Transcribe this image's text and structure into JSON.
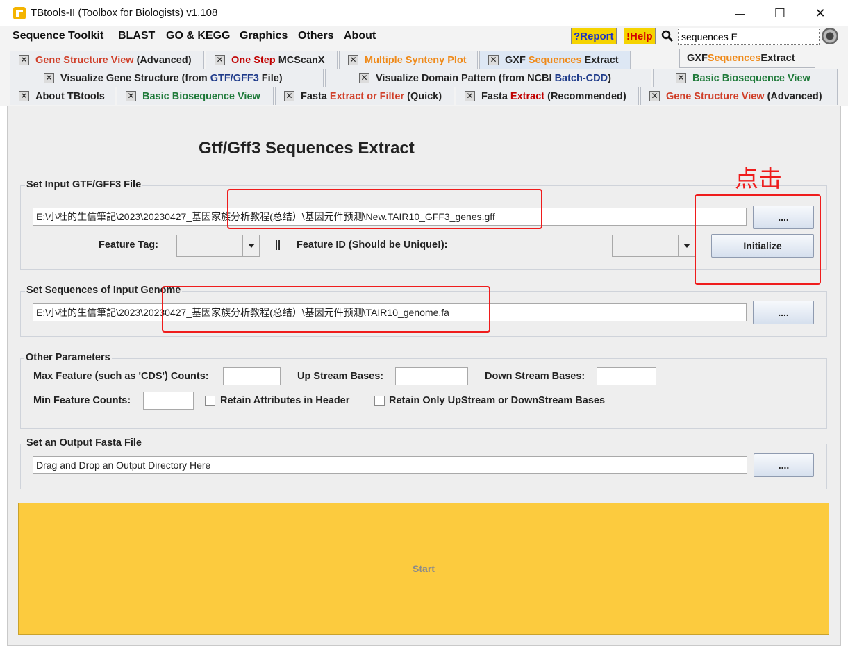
{
  "window": {
    "title": "TBtools-II (Toolbox for Biologists) v1.108",
    "minimize": "—",
    "maximize": "☐",
    "close": "✕"
  },
  "menu": {
    "items": [
      "Sequence Toolkit",
      "BLAST",
      "GO & KEGG",
      "Graphics",
      "Others",
      "About"
    ],
    "report": "?Report",
    "help": "!Help",
    "search_value": "sequences E"
  },
  "tooltip": {
    "prefix": "GXF ",
    "highlight": "Sequences",
    "suffix": " Extract"
  },
  "tabs": {
    "row1": [
      {
        "a": "Gene Structure View",
        "b": " (Advanced)"
      },
      {
        "a": "One Step ",
        "b": "MCScanX"
      },
      {
        "a": "Multiple Synteny Plot",
        "b": ""
      },
      {
        "a": "GXF ",
        "b": "Sequences",
        "c": " Extract"
      }
    ],
    "row2": [
      {
        "a": "Visualize Gene Structure (from ",
        "b": "GTF/GFF3",
        "c": " File)"
      },
      {
        "a": "Visualize Domain Pattern (from NCBI ",
        "b": "Batch-CDD",
        "c": ")"
      },
      {
        "a": "Basic Biosequence View"
      }
    ],
    "row3": [
      {
        "a": "About TBtools"
      },
      {
        "a": "Basic Biosequence View"
      },
      {
        "a": "Fasta ",
        "b": "Extract or Filter",
        "c": " (Quick)"
      },
      {
        "a": "Fasta ",
        "b": "Extract",
        "c": " (Recommended)"
      },
      {
        "a": "Gene Structure View",
        "b": " (Advanced)"
      }
    ]
  },
  "panel": {
    "title": "Gtf/Gff3 Sequences Extract",
    "gff_group": "Set Input GTF/GFF3 File",
    "gff_path": "E:\\小杜的生信筆記\\2023\\20230427_基因家族分析教程(总结）\\基因元件预测\\New.TAIR10_GFF3_genes.gff",
    "browse": "....",
    "feature_tag_label": "Feature Tag:",
    "separator": "||",
    "feature_id_label": "Feature ID (Should be Unique!):",
    "initialize": "Initialize",
    "genome_group": "Set Sequences of Input Genome",
    "genome_path": "E:\\小杜的生信筆記\\2023\\20230427_基因家族分析教程(总结）\\基因元件预测\\TAIR10_genome.fa",
    "params_group": "Other Parameters",
    "max_feature_label": "Max Feature (such as 'CDS') Counts:",
    "upstream_label": "Up Stream Bases:",
    "downstream_label": "Down Stream Bases:",
    "min_feature_label": "Min Feature Counts:",
    "retain_attr_label": "Retain Attributes in Header",
    "retain_only_label": "Retain Only UpStream or DownStream Bases",
    "output_group": "Set an Output Fasta File",
    "output_path": "Drag and Drop an Output Directory Here",
    "start": "Start"
  },
  "annotation": {
    "text": "点击"
  },
  "colors": {
    "start": "#fccb3e",
    "annotation": "#ef1c1c",
    "report_bg": "#f5d300"
  }
}
